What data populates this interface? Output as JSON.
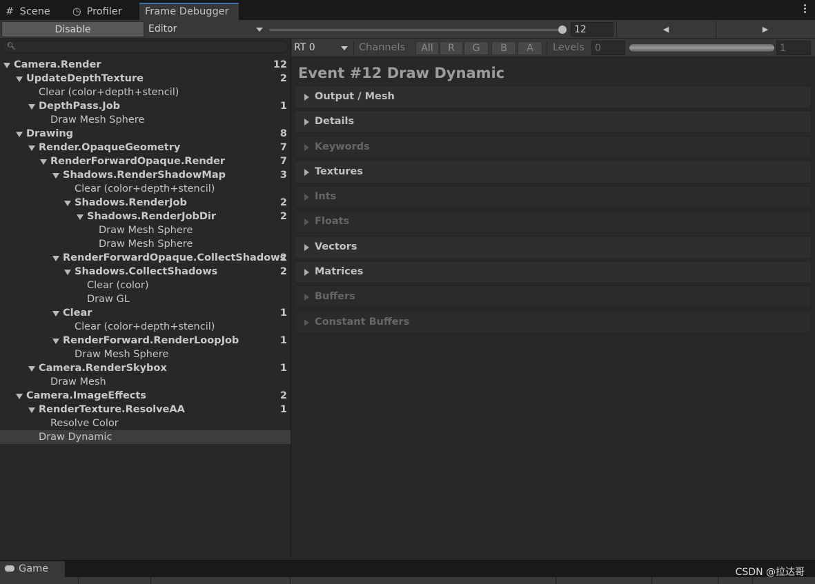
{
  "tabs": [
    {
      "label": "Scene",
      "icon": "grid-icon"
    },
    {
      "label": "Profiler",
      "icon": "stopwatch-icon"
    },
    {
      "label": "Frame Debugger",
      "icon": ""
    }
  ],
  "toolbar": {
    "disable_label": "Disable",
    "target_value": "Editor",
    "event_index": "12",
    "prev_icon": "◀",
    "next_icon": "▶"
  },
  "tree": [
    {
      "label": "Camera.Render",
      "count": "12",
      "depth": 0,
      "expandable": true
    },
    {
      "label": "UpdateDepthTexture",
      "count": "2",
      "depth": 1,
      "expandable": true
    },
    {
      "label": "Clear (color+depth+stencil)",
      "count": "",
      "depth": 2,
      "expandable": false
    },
    {
      "label": "DepthPass.Job",
      "count": "1",
      "depth": 2,
      "expandable": true
    },
    {
      "label": "Draw Mesh Sphere",
      "count": "",
      "depth": 3,
      "expandable": false
    },
    {
      "label": "Drawing",
      "count": "8",
      "depth": 1,
      "expandable": true
    },
    {
      "label": "Render.OpaqueGeometry",
      "count": "7",
      "depth": 2,
      "expandable": true
    },
    {
      "label": "RenderForwardOpaque.Render",
      "count": "7",
      "depth": 3,
      "expandable": true
    },
    {
      "label": "Shadows.RenderShadowMap",
      "count": "3",
      "depth": 4,
      "expandable": true
    },
    {
      "label": "Clear (color+depth+stencil)",
      "count": "",
      "depth": 5,
      "expandable": false
    },
    {
      "label": "Shadows.RenderJob",
      "count": "2",
      "depth": 5,
      "expandable": true
    },
    {
      "label": "Shadows.RenderJobDir",
      "count": "2",
      "depth": 6,
      "expandable": true
    },
    {
      "label": "Draw Mesh Sphere",
      "count": "",
      "depth": 7,
      "expandable": false
    },
    {
      "label": "Draw Mesh Sphere",
      "count": "",
      "depth": 7,
      "expandable": false
    },
    {
      "label": "RenderForwardOpaque.CollectShadows",
      "count": "2",
      "depth": 4,
      "expandable": true
    },
    {
      "label": "Shadows.CollectShadows",
      "count": "2",
      "depth": 5,
      "expandable": true
    },
    {
      "label": "Clear (color)",
      "count": "",
      "depth": 6,
      "expandable": false
    },
    {
      "label": "Draw GL",
      "count": "",
      "depth": 6,
      "expandable": false
    },
    {
      "label": "Clear",
      "count": "1",
      "depth": 4,
      "expandable": true
    },
    {
      "label": "Clear (color+depth+stencil)",
      "count": "",
      "depth": 5,
      "expandable": false
    },
    {
      "label": "RenderForward.RenderLoopJob",
      "count": "1",
      "depth": 4,
      "expandable": true
    },
    {
      "label": "Draw Mesh Sphere",
      "count": "",
      "depth": 5,
      "expandable": false
    },
    {
      "label": "Camera.RenderSkybox",
      "count": "1",
      "depth": 2,
      "expandable": true
    },
    {
      "label": "Draw Mesh",
      "count": "",
      "depth": 3,
      "expandable": false
    },
    {
      "label": "Camera.ImageEffects",
      "count": "2",
      "depth": 1,
      "expandable": true
    },
    {
      "label": "RenderTexture.ResolveAA",
      "count": "1",
      "depth": 2,
      "expandable": true
    },
    {
      "label": "Resolve Color",
      "count": "",
      "depth": 3,
      "expandable": false
    },
    {
      "label": "Draw Dynamic",
      "count": "",
      "depth": 2,
      "expandable": false,
      "selected": true
    }
  ],
  "right": {
    "rt_value": "RT 0",
    "channels_label": "Channels",
    "channel_buttons": [
      "All",
      "R",
      "G",
      "B",
      "A"
    ],
    "levels_label": "Levels",
    "levels_min": "0",
    "levels_max": "1",
    "event_title": "Event #12 Draw Dynamic",
    "sections": [
      {
        "label": "Output / Mesh",
        "enabled": true
      },
      {
        "label": "Details",
        "enabled": true
      },
      {
        "label": "Keywords",
        "enabled": false
      },
      {
        "label": "Textures",
        "enabled": true
      },
      {
        "label": "Ints",
        "enabled": false
      },
      {
        "label": "Floats",
        "enabled": false
      },
      {
        "label": "Vectors",
        "enabled": true
      },
      {
        "label": "Matrices",
        "enabled": true
      },
      {
        "label": "Buffers",
        "enabled": false
      },
      {
        "label": "Constant Buffers",
        "enabled": false
      }
    ]
  },
  "bottom": {
    "game_tab": "Game",
    "game_icon": "gamepad-icon",
    "watermark": "CSDN @拉达哥"
  },
  "colors": {
    "accent": "#3a72b0",
    "panel": "#282828",
    "toolbar": "#383838",
    "selected_row": "#3d3d3d"
  }
}
